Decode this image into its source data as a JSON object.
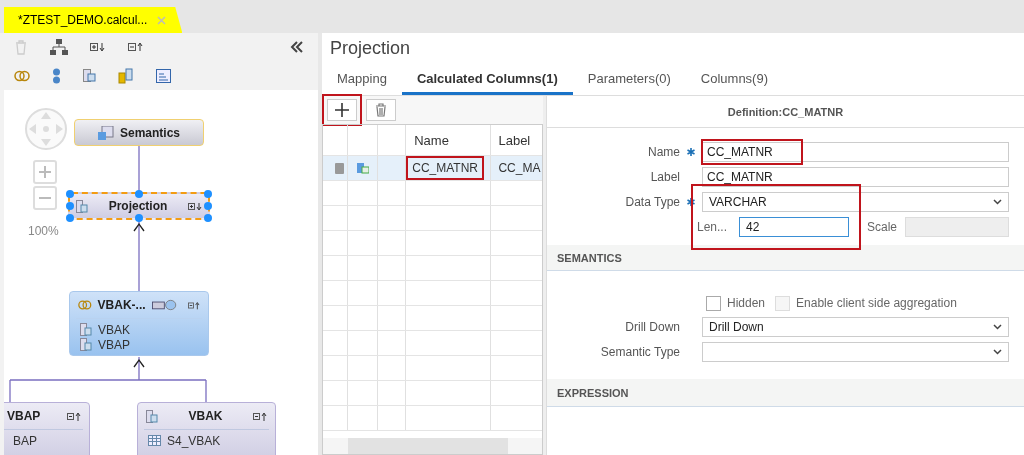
{
  "editor_tab": {
    "title": "*ZTEST_DEMO.calcul..."
  },
  "diagram": {
    "zoom": "100%",
    "nodes": [
      {
        "kind": "semantics",
        "title": "Semantics",
        "selected": false
      },
      {
        "kind": "projection",
        "title": "Projection",
        "selected": true
      },
      {
        "kind": "join",
        "title": "VBAK-...",
        "selected": false,
        "items": [
          "VBAK",
          "VBAP"
        ]
      },
      {
        "kind": "left_source",
        "title": "VBAP",
        "selected": false,
        "items": [
          "BAP"
        ]
      },
      {
        "kind": "right_source",
        "title": "VBAK",
        "selected": false,
        "items": [
          "S4_VBAK"
        ]
      }
    ]
  },
  "panel": {
    "title": "Projection",
    "tabs": [
      {
        "label": "Mapping",
        "selected": false
      },
      {
        "label": "Calculated Columns(1)",
        "selected": true
      },
      {
        "label": "Parameters(0)",
        "selected": false
      },
      {
        "label": "Columns(9)",
        "selected": false
      }
    ]
  },
  "toolbar": {
    "add_highlighted": true
  },
  "grid": {
    "columns": [
      "Name",
      "Label"
    ],
    "rows": [
      {
        "name": "CC_MATNR",
        "label": "CC_MA",
        "selected": true,
        "highlighted": true
      }
    ]
  },
  "definition": {
    "title": "Definition:CC_MATNR",
    "fields": [
      {
        "kind": "text",
        "label": "Name",
        "required": true,
        "value": "CC_MATNR",
        "highlighted": true
      },
      {
        "kind": "text",
        "label": "Label",
        "required": false,
        "value": "CC_MATNR",
        "highlighted": false
      },
      {
        "kind": "select",
        "label": "Data Type",
        "required": true,
        "value": "VARCHAR",
        "highlighted": false
      }
    ],
    "length": {
      "label": "Len...",
      "value": "42",
      "focused": true
    },
    "scale": {
      "label": "Scale",
      "disabled": true
    },
    "type_group_highlighted": true
  },
  "semantics": {
    "title": "SEMANTICS",
    "checkboxes": [
      {
        "label": "Hidden",
        "checked": false,
        "disabled": false
      },
      {
        "label": "Enable client side aggregation",
        "checked": false,
        "disabled": true
      }
    ],
    "selects": [
      {
        "label": "Drill Down",
        "value": "Drill Down"
      },
      {
        "label": "Semantic Type"
      }
    ]
  },
  "expression": {
    "title": "EXPRESSION"
  }
}
